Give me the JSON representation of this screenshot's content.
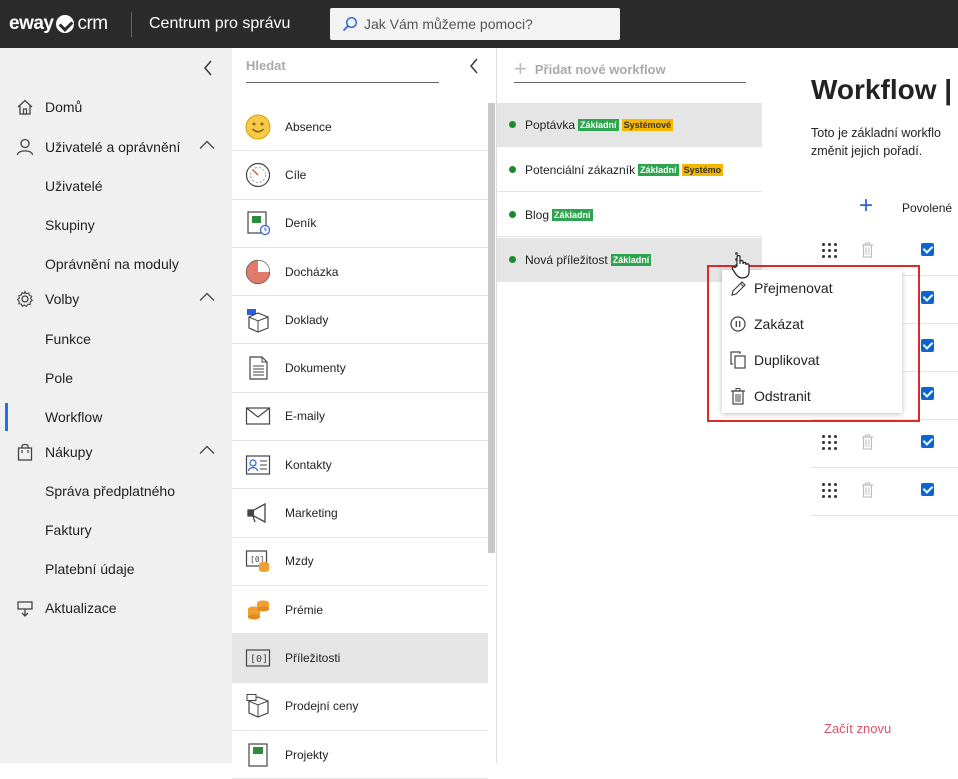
{
  "topbar": {
    "logo_text": "eway",
    "logo_suffix": "crm",
    "title": "Centrum pro správu",
    "search_placeholder": "Jak Vám můžeme pomoci?"
  },
  "sidebar": {
    "items": [
      {
        "label": "Domů",
        "icon": "home-icon"
      },
      {
        "label": "Uživatelé a oprávnění",
        "icon": "user-icon"
      },
      {
        "label": "Uživatelé"
      },
      {
        "label": "Skupiny"
      },
      {
        "label": "Oprávnění na moduly"
      },
      {
        "label": "Volby",
        "icon": "gear-icon"
      },
      {
        "label": "Funkce"
      },
      {
        "label": "Pole"
      },
      {
        "label": "Workflow",
        "active": true
      },
      {
        "label": "Nákupy",
        "icon": "bag-icon"
      },
      {
        "label": "Správa předplatného"
      },
      {
        "label": "Faktury"
      },
      {
        "label": "Platební údaje"
      },
      {
        "label": "Aktualizace",
        "icon": "update-icon"
      }
    ]
  },
  "modules": {
    "search_placeholder": "Hledat",
    "items": [
      {
        "label": "Absence",
        "icon": "smiley-icon"
      },
      {
        "label": "Cíle",
        "icon": "target-icon"
      },
      {
        "label": "Deník",
        "icon": "journal-icon"
      },
      {
        "label": "Docházka",
        "icon": "attendance-clock-icon"
      },
      {
        "label": "Doklady",
        "icon": "box-icon"
      },
      {
        "label": "Dokumenty",
        "icon": "document-icon"
      },
      {
        "label": "E-maily",
        "icon": "envelope-icon"
      },
      {
        "label": "Kontakty",
        "icon": "contact-card-icon"
      },
      {
        "label": "Marketing",
        "icon": "megaphone-icon"
      },
      {
        "label": "Mzdy",
        "icon": "wages-icon"
      },
      {
        "label": "Prémie",
        "icon": "coins-icon"
      },
      {
        "label": "Příležitosti",
        "icon": "opportunity-icon",
        "selected": true
      },
      {
        "label": "Prodejní ceny",
        "icon": "price-box-icon"
      },
      {
        "label": "Projekty",
        "icon": "project-icon"
      }
    ]
  },
  "workflows": {
    "add_label": "Přidat nové workflow",
    "items": [
      {
        "label": "Poptávka",
        "badges": [
          "Základní",
          "Systémové"
        ]
      },
      {
        "label": "Potenciální zákazník",
        "badges": [
          "Základní",
          "Systémo"
        ]
      },
      {
        "label": "Blog",
        "badges": [
          "Základní"
        ]
      },
      {
        "label": "Nová příležitost",
        "badges": [
          "Základní"
        ]
      }
    ]
  },
  "main": {
    "title": "Workflow |",
    "desc_line1": "Toto je základní workflo",
    "desc_line2": "změnit jejich pořadí.",
    "col_enabled": "Povolené",
    "restart": "Začít znovu"
  },
  "context_menu": {
    "items": [
      {
        "label": "Přejmenovat",
        "icon": "pencil-icon"
      },
      {
        "label": "Zakázat",
        "icon": "pause-icon"
      },
      {
        "label": "Duplikovat",
        "icon": "copy-icon"
      },
      {
        "label": "Odstranit",
        "icon": "trash-icon"
      }
    ]
  },
  "colors": {
    "accent": "#1a73e8",
    "badge_green": "#2da44e",
    "badge_yellow": "#f5b800",
    "highlight_red": "#d92b2b"
  }
}
